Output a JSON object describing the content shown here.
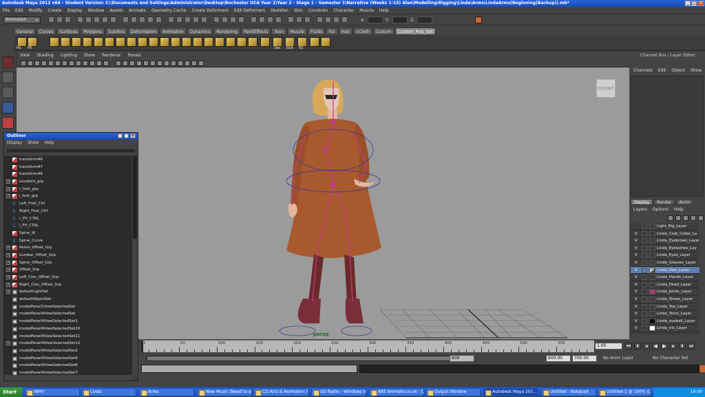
{
  "window": {
    "title": "Autodesk Maya 2012 x64 - Student Version: C:\\Documents and Settings\\Administrator\\Desktop\\Rochester UCA Year 2\\Year 2 - Stage 1 - Semester 1\\Narrative (Weeks 1-15) Alan\\Modelling\\Rigging\\Linda\\Arms\\LindaArms(Beginning(Backup)).mb*"
  },
  "menubar": [
    "File",
    "Edit",
    "Modify",
    "Create",
    "Display",
    "Window",
    "Assets",
    "Animate",
    "Geometry Cache",
    "Create Deformers",
    "Edit Deformers",
    "Skeleton",
    "Skin",
    "Constrain",
    "Character",
    "Muscle",
    "Help"
  ],
  "status_line": {
    "mode": "Animation",
    "x_label": "X:",
    "y_label": "Y:",
    "z_label": "Z:"
  },
  "shelf_tabs": [
    "General",
    "Curves",
    "Surfaces",
    "Polygons",
    "Subdivs",
    "Deformation",
    "Animation",
    "Dynamics",
    "Rendering",
    "PaintEffects",
    "Toon",
    "Muscle",
    "Fluids",
    "Fur",
    "Hair",
    "nCloth",
    "Custom",
    "Custom_Poly_Set"
  ],
  "shelf_active": "Custom_Poly_Set",
  "shelf_labels": [
    "Hs",
    "FR",
    "Des",
    "SSA",
    "SS"
  ],
  "panel_menu": [
    "View",
    "Shading",
    "Lighting",
    "Show",
    "Renderer",
    "Panels"
  ],
  "viewport": {
    "viewcube": "FRONT",
    "camera": "persp",
    "background": "#9b9b9b"
  },
  "outliner": {
    "title": "Outliner",
    "menu": [
      "Display",
      "Show",
      "Help"
    ],
    "items": [
      {
        "label": "transform46",
        "icon": "transform-icon",
        "expandable": false
      },
      {
        "label": "transform47",
        "icon": "transform-icon",
        "expandable": false
      },
      {
        "label": "transform48",
        "icon": "transform-icon",
        "expandable": false
      },
      {
        "label": "Locators_grp",
        "icon": "transform-icon",
        "expandable": true
      },
      {
        "label": "r_foot_grp",
        "icon": "transform-icon",
        "expandable": true
      },
      {
        "label": "l_foot_grp",
        "icon": "transform-icon",
        "expandable": true
      },
      {
        "label": "Left_Foot_Ctrl",
        "icon": "curve-icon",
        "expandable": false
      },
      {
        "label": "Right_Foot_Ctrl",
        "icon": "curve-icon",
        "expandable": false
      },
      {
        "label": "r_PV_CTRL",
        "icon": "curve-icon",
        "expandable": false
      },
      {
        "label": "l_PV_CTRL",
        "icon": "curve-icon",
        "expandable": false
      },
      {
        "label": "Spine_IK",
        "icon": "ik-icon",
        "expandable": false
      },
      {
        "label": "Spine_Curve",
        "icon": "curve-icon",
        "expandable": false
      },
      {
        "label": "Pelvis_Offset_Grp",
        "icon": "transform-icon",
        "expandable": true
      },
      {
        "label": "Lumbar_Offset_Grp",
        "icon": "transform-icon",
        "expandable": true
      },
      {
        "label": "Spine_Offset_Grp",
        "icon": "transform-icon",
        "expandable": true
      },
      {
        "label": "Offset_Grp",
        "icon": "transform-icon",
        "expandable": true
      },
      {
        "label": "Left_Clav_Offset_Grp",
        "icon": "transform-icon",
        "expandable": true
      },
      {
        "label": "Right_Clav_Offset_Grp",
        "icon": "transform-icon",
        "expandable": true
      },
      {
        "label": "defaultLightSet",
        "icon": "set-icon",
        "expandable": true
      },
      {
        "label": "defaultObjectSet",
        "icon": "set-icon",
        "expandable": false
      },
      {
        "label": "modelPanel1ViewSelectedSet",
        "icon": "set-icon",
        "expandable": false
      },
      {
        "label": "modelPanel4ViewSelectedSet",
        "icon": "set-icon",
        "expandable": false
      },
      {
        "label": "modelPanel4ViewSelectedSet1",
        "icon": "set-icon",
        "expandable": false
      },
      {
        "label": "modelPanel4ViewSelectedSet10",
        "icon": "set-icon",
        "expandable": false
      },
      {
        "label": "modelPanel4ViewSelectedSet11",
        "icon": "set-icon",
        "expandable": false
      },
      {
        "label": "modelPanel4ViewSelectedSet12",
        "icon": "set-icon",
        "expandable": true
      },
      {
        "label": "modelPanel4ViewSelectedSet2",
        "icon": "set-icon",
        "expandable": false
      },
      {
        "label": "modelPanel4ViewSelectedSet4",
        "icon": "set-icon",
        "expandable": false
      },
      {
        "label": "modelPanel4ViewSelectedSet6",
        "icon": "set-icon",
        "expandable": false
      },
      {
        "label": "modelPanel4ViewSelectedSet7",
        "icon": "set-icon",
        "expandable": false
      }
    ]
  },
  "channel_box": {
    "title": "Channel Box / Layer Editor",
    "menu": [
      "Channels",
      "Edit",
      "Object",
      "Show"
    ]
  },
  "layer_editor": {
    "tabs": [
      "Display",
      "Render",
      "Anim"
    ],
    "active_tab": "Display",
    "menu": [
      "Layers",
      "Options",
      "Help"
    ],
    "layers": [
      {
        "name": "Light_Rig_Layer",
        "visible": "",
        "color": "",
        "selected": false
      },
      {
        "name": "Linda_Coat_Collar_La",
        "visible": "V",
        "color": "",
        "selected": false
      },
      {
        "name": "Linda_Eyebrows_Layer",
        "visible": "V",
        "color": "",
        "selected": false
      },
      {
        "name": "Linda_Eyelashes_Lay",
        "visible": "V",
        "color": "",
        "selected": false
      },
      {
        "name": "Linda_Eyes_Layer",
        "visible": "V",
        "color": "",
        "selected": false
      },
      {
        "name": "Linda_Glasses_Layer",
        "visible": "V",
        "color": "",
        "selected": false
      },
      {
        "name": "Linda_Hair_Layer",
        "visible": "V",
        "color": "",
        "selected": true
      },
      {
        "name": "Linda_Hands_Layer",
        "visible": "V",
        "color": "",
        "selected": false
      },
      {
        "name": "Linda_Head_Layer",
        "visible": "V",
        "color": "",
        "selected": false
      },
      {
        "name": "Linda_Joints_Layer",
        "visible": "V",
        "color": "#a83a6a",
        "selected": false
      },
      {
        "name": "Linda_Shoes_Layer",
        "visible": "V",
        "color": "",
        "selected": false
      },
      {
        "name": "Linda_Top_Layer",
        "visible": "V",
        "color": "",
        "selected": false
      },
      {
        "name": "Linda_Torso_Layer",
        "visible": "V",
        "color": "",
        "selected": false
      },
      {
        "name": "Linda_eyeball_Layer",
        "visible": "V",
        "color": "#000000",
        "selected": false
      },
      {
        "name": "Linda_iris_Layer",
        "visible": "V",
        "color": "#ffffff",
        "selected": false
      }
    ]
  },
  "timeline": {
    "ticks": [
      "1",
      "50",
      "100",
      "150",
      "200",
      "250",
      "300",
      "350",
      "400",
      "450",
      "500",
      "550"
    ],
    "current_frame": "1.00"
  },
  "range": {
    "start": "1.00",
    "range_start": "1.00",
    "range_end": "600",
    "end": "600.00",
    "max": "700.00",
    "anim_layer": "No Anim Layer",
    "character_set": "No Character Set"
  },
  "taskbar": {
    "start_label": "Start",
    "tasks": [
      "WMV",
      "Linda",
      "Arms",
      "New Music (Need to sor...",
      "CG Arts & Animation Tu...",
      "UO Radio - Windows In...",
      "KRE Animate.co.uk - Q...",
      "Output Window",
      "Autodesk Maya 201...",
      "Untitled - Notepad",
      "Untitled-1 @ 100% (La..."
    ],
    "active_task": "Autodesk Maya 201...",
    "clock": "16:00"
  }
}
